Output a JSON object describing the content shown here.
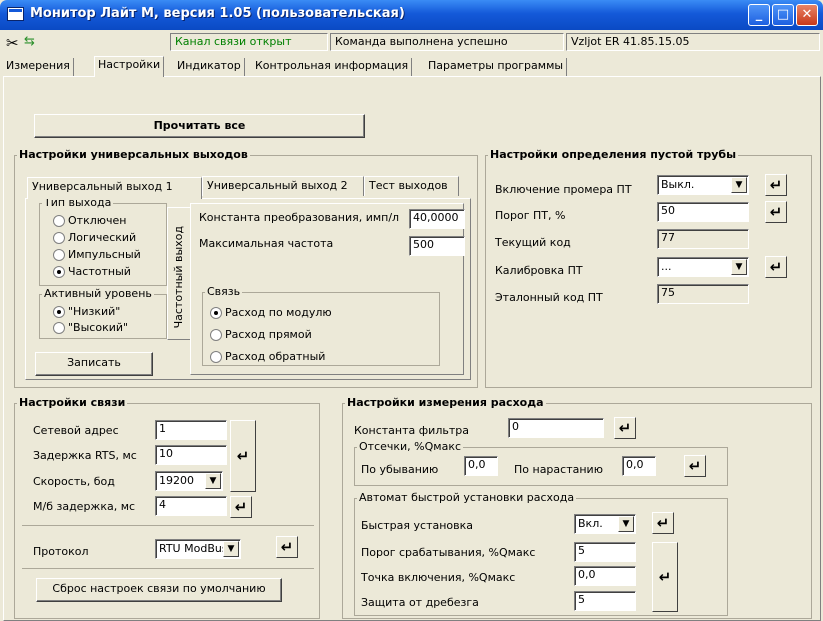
{
  "window": {
    "title": "Монитор Лайт М, версия 1.05 (пользовательская)"
  },
  "statusbar": {
    "channel": "Канал связи открыт",
    "command": "Команда выполнена успешно",
    "device": "Vzljot ER 41.85.15.05"
  },
  "tabs": [
    "Измерения",
    "Настройки",
    "Индикатор",
    "Контрольная информация",
    "Параметры программы"
  ],
  "read_all": "Прочитать все",
  "outputs": {
    "title": "Настройки универсальных выходов",
    "tabs": [
      "Универсальный выход 1",
      "Универсальный выход 2",
      "Тест выходов"
    ],
    "type_group": "Тип выхода",
    "types": [
      "Отключен",
      "Логический",
      "Импульсный",
      "Частотный"
    ],
    "level_group": "Активный уровень",
    "levels": [
      "\"Низкий\"",
      "\"Высокий\""
    ],
    "write": "Записать",
    "side_tab": "Частотный выход",
    "const_label": "Константа преобразования, имп/л",
    "const_value": "40,0000",
    "maxfreq_label": "Максимальная частота",
    "maxfreq_value": "500",
    "link_group": "Связь",
    "links": [
      "Расход по модулю",
      "Расход прямой",
      "Расход обратный"
    ]
  },
  "empty_pipe": {
    "title": "Настройки определения пустой трубы",
    "enable_label": "Включение промера ПТ",
    "enable_value": "Выкл.",
    "threshold_label": "Порог ПТ, %",
    "threshold_value": "50",
    "current_label": "Текущий код",
    "current_value": "77",
    "calib_label": "Калибровка ПТ",
    "calib_value": "...",
    "ref_label": "Эталонный код ПТ",
    "ref_value": "75"
  },
  "comm": {
    "title": "Настройки связи",
    "addr_label": "Сетевой адрес",
    "addr_value": "1",
    "rts_label": "Задержка RTS, мс",
    "rts_value": "10",
    "speed_label": "Скорость, бод",
    "speed_value": "19200",
    "delay_label": "М/б задержка, мс",
    "delay_value": "4",
    "proto_label": "Протокол",
    "proto_value": "RTU ModBus",
    "reset": "Сброс настроек связи по умолчанию"
  },
  "flow": {
    "title": "Настройки измерения расхода",
    "filter_label": "Константа фильтра",
    "filter_value": "0",
    "cutoff_group": "Отсечки, %Qмакс",
    "dec_label": "По убыванию",
    "dec_value": "0,0",
    "inc_label": "По нарастанию",
    "inc_value": "0,0",
    "auto_group": "Автомат быстрой установки расхода",
    "fast_label": "Быстрая установка",
    "fast_value": "Вкл.",
    "trig_label": "Порог срабатывания, %Qмакс",
    "trig_value": "5",
    "point_label": "Точка включения, %Qмакс",
    "point_value": "0,0",
    "bounce_label": "Защита от дребезга",
    "bounce_value": "5"
  }
}
